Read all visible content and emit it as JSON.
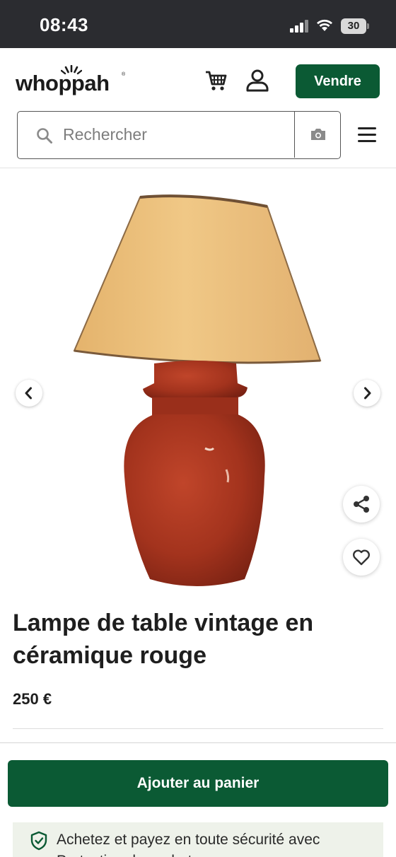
{
  "status_bar": {
    "time": "08:43",
    "battery": "30"
  },
  "header": {
    "logo_text": "whoppah",
    "logo_mark": "®",
    "sell_label": "Vendre",
    "icons": [
      "cart-icon",
      "user-icon",
      "menu-icon"
    ]
  },
  "search": {
    "placeholder": "Rechercher",
    "value": ""
  },
  "product": {
    "title": "Lampe de table vintage en céramique rouge",
    "price": "250 €",
    "image_description_colors": {
      "shade": "#e9bd79",
      "vase": "#a8351f"
    }
  },
  "actions": {
    "add_to_cart_label": "Ajouter au panier",
    "protection_text": "Achetez et payez en toute sécurité avec Protection des acheteurs"
  },
  "colors": {
    "brand_green": "#0b5a34",
    "status_bar": "#2b2c30"
  }
}
